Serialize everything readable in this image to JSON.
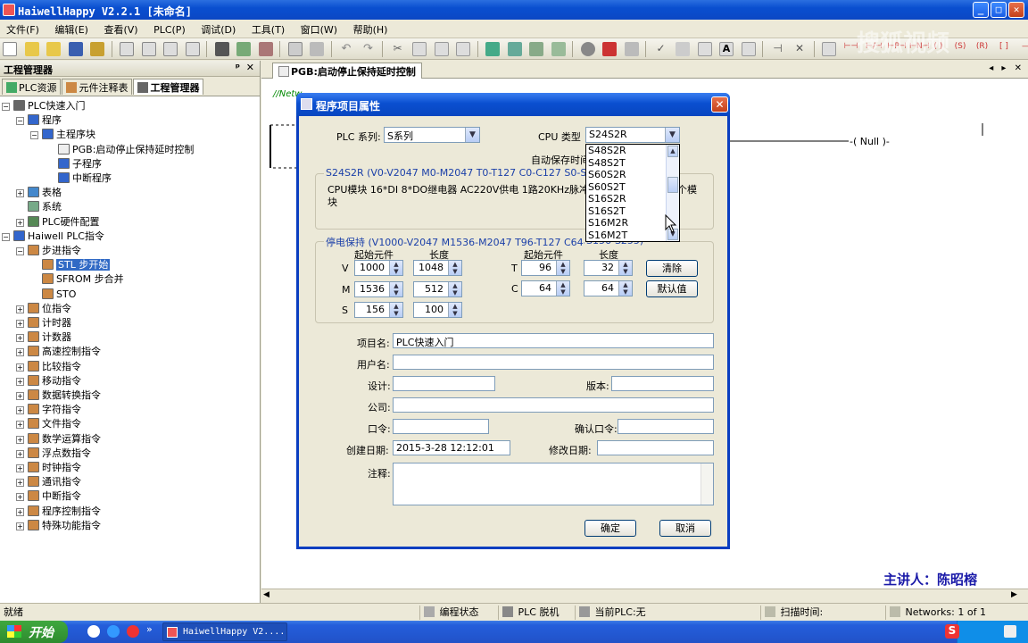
{
  "window": {
    "title": "HaiwellHappy V2.2.1 [未命名]",
    "buttons": {
      "min": "_",
      "max": "□",
      "close": "✕"
    }
  },
  "menu": [
    "文件(F)",
    "编辑(E)",
    "查看(V)",
    "PLC(P)",
    "调试(D)",
    "工具(T)",
    "窗口(W)",
    "帮助(H)"
  ],
  "left_pane": {
    "title": "工程管理器",
    "pin": "ᵖ",
    "close": "✕",
    "tabs": [
      "PLC资源",
      "元件注释表",
      "工程管理器"
    ],
    "tree": [
      {
        "label": "PLC快速入门",
        "exp": "−"
      },
      {
        "label": "程序",
        "exp": "−"
      },
      {
        "label": "主程序块",
        "exp": "−"
      },
      {
        "label": "PGB:启动停止保持延时控制",
        "exp": ""
      },
      {
        "label": "子程序",
        "exp": ""
      },
      {
        "label": "中断程序",
        "exp": ""
      },
      {
        "label": "表格",
        "exp": "+"
      },
      {
        "label": "系统",
        "exp": ""
      },
      {
        "label": "PLC硬件配置",
        "exp": "+"
      },
      {
        "label": "Haiwell PLC指令",
        "exp": "−"
      },
      {
        "label": "步进指令",
        "exp": "−"
      },
      {
        "label": "STL 步开始",
        "exp": ""
      },
      {
        "label": "SFROM 步合并",
        "exp": ""
      },
      {
        "label": "STO",
        "exp": ""
      },
      {
        "label": "位指令",
        "exp": "+"
      },
      {
        "label": "计时器",
        "exp": "+"
      },
      {
        "label": "计数器",
        "exp": "+"
      },
      {
        "label": "高速控制指令",
        "exp": "+"
      },
      {
        "label": "比较指令",
        "exp": "+"
      },
      {
        "label": "移动指令",
        "exp": "+"
      },
      {
        "label": "数据转换指令",
        "exp": "+"
      },
      {
        "label": "字符指令",
        "exp": "+"
      },
      {
        "label": "文件指令",
        "exp": "+"
      },
      {
        "label": "数学运算指令",
        "exp": "+"
      },
      {
        "label": "浮点数指令",
        "exp": "+"
      },
      {
        "label": "时钟指令",
        "exp": "+"
      },
      {
        "label": "通讯指令",
        "exp": "+"
      },
      {
        "label": "中断指令",
        "exp": "+"
      },
      {
        "label": "程序控制指令",
        "exp": "+"
      },
      {
        "label": "特殊功能指令",
        "exp": "+"
      }
    ]
  },
  "editor": {
    "tab": "PGB:启动停止保持延时控制",
    "tab_arrows": "◂ ▸ ✕",
    "network_comment": "//Netw",
    "null_coil": "-( Null )-"
  },
  "lecturer": "主讲人：陈昭榕",
  "watermark": "搜狐视频",
  "dialog": {
    "title": "程序项目属性",
    "plc_series_label": "PLC 系列:",
    "plc_series_value": "S系列",
    "cpu_type_label": "CPU 类型",
    "cpu_type_value": "S24S2R",
    "auto_save_label": "自动保存时间",
    "cpu_group_title": "S24S2R (V0-V2047  M0-M2047  T0-T127  C0-C127  S0-S25",
    "cpu_desc_line1": "CPU模块 16*DI 8*DO继电器 AC220V供电 1路20KHz脉冲输",
    "cpu_desc_line1_tail": "个模",
    "cpu_desc_line2": "块",
    "cpu_options": [
      "S48S2R",
      "S48S2T",
      "S60S2R",
      "S60S2T",
      "S16S2R",
      "S16S2T",
      "S16M2R",
      "S16M2T"
    ],
    "retain_group_title": "停电保持 (V1000-V2047 M1536-M2047 T96-T127 C64-C127",
    "retain_group_tail": "S156-S255)",
    "col_start": "起始元件",
    "col_length": "长度",
    "rows_left": [
      {
        "name": "V",
        "start": "1000",
        "len": "1048"
      },
      {
        "name": "M",
        "start": "1536",
        "len": "512"
      },
      {
        "name": "S",
        "start": "156",
        "len": "100"
      }
    ],
    "rows_right": [
      {
        "name": "T",
        "start": "96",
        "len": "32"
      },
      {
        "name": "C",
        "start": "64",
        "len": "64"
      }
    ],
    "clear_btn": "清除",
    "default_btn": "默认值",
    "project_name_label": "项目名:",
    "project_name_value": "PLC快速入门",
    "user_label": "用户名:",
    "design_label": "设计:",
    "version_label": "版本:",
    "company_label": "公司:",
    "password_label": "口令:",
    "confirm_password_label": "确认口令:",
    "created_label": "创建日期:",
    "created_value": "2015-3-28 12:12:01",
    "modified_label": "修改日期:",
    "notes_label": "注释:",
    "ok_btn": "确定",
    "cancel_btn": "取消"
  },
  "status": {
    "ready": "就绪",
    "edit_state": "编程状态",
    "plc_offline": "PLC 脱机",
    "current_plc": "当前PLC:无",
    "scan_time": "扫描时间:",
    "networks": "Networks:  1 of 1"
  },
  "taskbar": {
    "start": "开始",
    "item": "HaiwellHappy V2....",
    "more": "»"
  },
  "colors": {
    "title_blue": "#0a4fd0",
    "group_title": "#1a3fa8",
    "lecturer": "#1a1aa8",
    "selection": "#316ac5"
  }
}
